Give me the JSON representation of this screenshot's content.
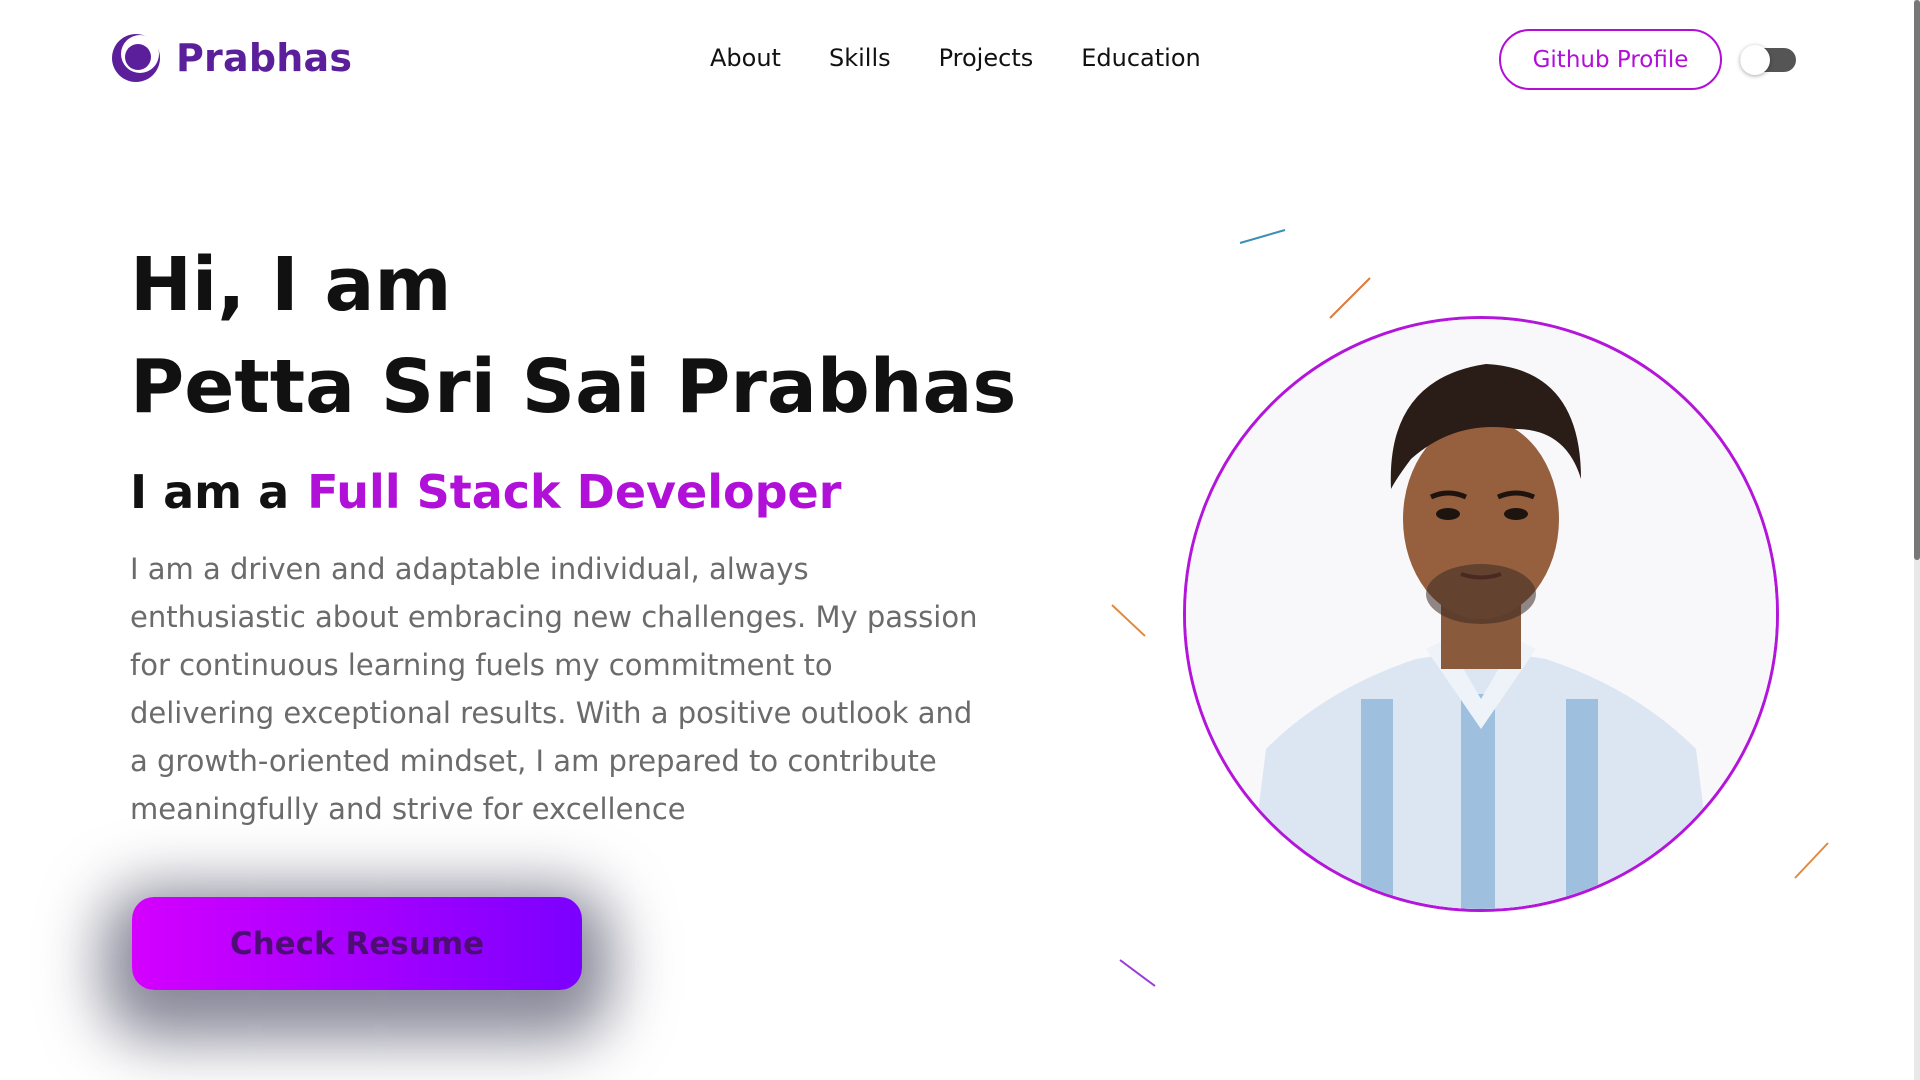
{
  "navbar": {
    "brand": "Prabhas",
    "links": [
      "About",
      "Skills",
      "Projects",
      "Education"
    ],
    "github_button": "Github Profile",
    "theme_toggle_state": "off"
  },
  "hero": {
    "greeting": "Hi, I am",
    "name": "Petta Sri Sai Prabhas",
    "role_prefix": "I am a",
    "role": "Full Stack Developer",
    "bio": "I am a driven and adaptable individual, always enthusiastic about embracing new challenges. My passion for continuous learning fuels my commitment to delivering exceptional results. With a positive outlook and a growth-oriented mindset, I am prepared to contribute meaningfully and strive for excellence",
    "resume_button": "Check Resume"
  },
  "colors": {
    "brand": "#5b1f9b",
    "accent": "#b010d8",
    "button_gradient_start": "#d400ff",
    "button_gradient_end": "#7b00ff"
  },
  "icons": {
    "logo": "crescent-logo-icon",
    "portrait": "profile-photo"
  }
}
